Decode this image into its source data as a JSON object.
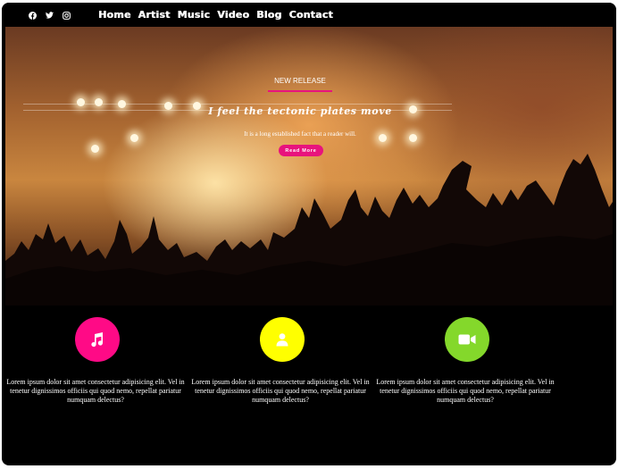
{
  "header": {
    "social": [
      {
        "icon": "facebook-icon"
      },
      {
        "icon": "twitter-icon"
      },
      {
        "icon": "instagram-icon"
      }
    ],
    "nav": [
      "Home",
      "Artist",
      "Music",
      "Video",
      "Blog",
      "Contact"
    ]
  },
  "hero": {
    "tag": "NEW RELEASE",
    "title": "I feel the tectonic plates move",
    "subtitle": "It is a long established fact that a reader will.",
    "button": "Read More",
    "accent": "#e8137d"
  },
  "features": [
    {
      "icon": "music-note-icon",
      "color": "#ff0a86",
      "text": "Lorem ipsum dolor sit amet consectetur adipisicing elit. Vel in tenetur dignissimos officiis qui quod nemo, repellat pariatur numquam delectus?"
    },
    {
      "icon": "user-icon",
      "color": "#ffff00",
      "text": "Lorem ipsum dolor sit amet consectetur adipisicing elit. Vel in tenetur dignissimos officiis qui quod nemo, repellat pariatur numquam delectus?"
    },
    {
      "icon": "video-camera-icon",
      "color": "#84d82b",
      "text": "Lorem ipsum dolor sit amet consectetur adipisicing elit. Vel in tenetur dignissimos officiis qui quod nemo, repellat pariatur numquam delectus?"
    }
  ]
}
